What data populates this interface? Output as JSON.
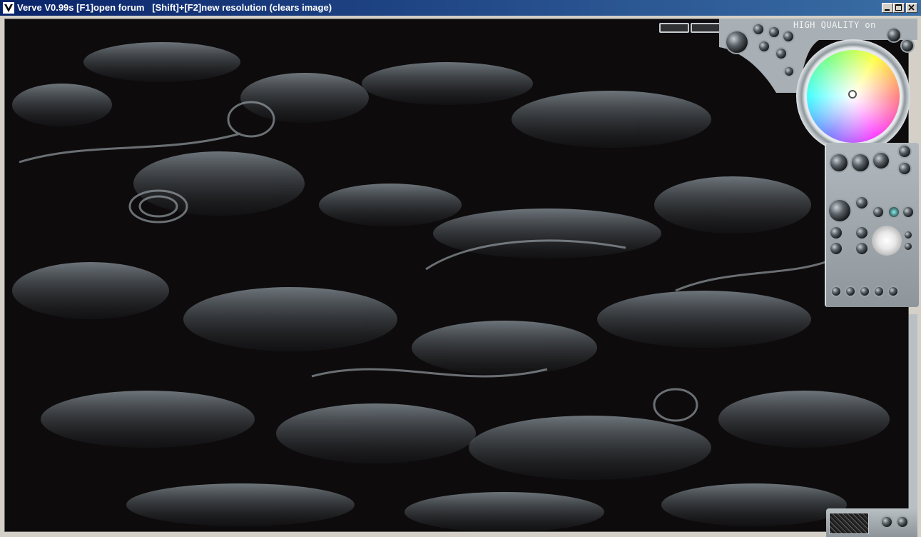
{
  "window": {
    "title": "Verve V0.99s [F1]open forum   [Shift]+[F2]new resolution (clears image)",
    "controls": [
      "minimize-icon",
      "maximize-icon",
      "close-icon"
    ]
  },
  "toolbar": {
    "high_quality_label": "HIGH QUALITY on"
  },
  "colors": {
    "titlebar_start": "#0a246a",
    "titlebar_end": "#3a6ea5",
    "canvas_bg": "#0d0b0c",
    "panel_metal": "#b2b9be"
  },
  "icons": {
    "app": "verve-app-icon",
    "color_wheel": "color-wheel",
    "brush_preview": "brush-preview-icon"
  }
}
